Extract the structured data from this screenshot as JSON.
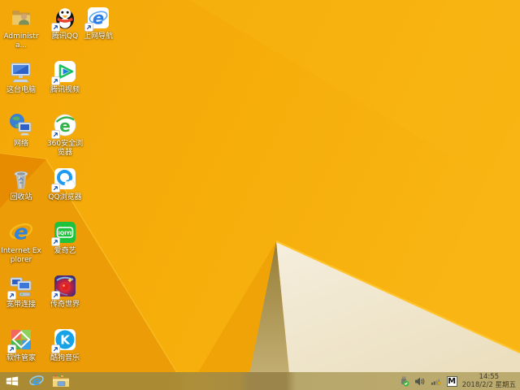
{
  "desktop": {
    "icons": {
      "admin": {
        "label": "Administra..."
      },
      "qq": {
        "label": "腾讯QQ"
      },
      "webnav": {
        "label": "上网导航"
      },
      "thispc": {
        "label": "这台电脑"
      },
      "tvideo": {
        "label": "腾讯视频"
      },
      "network": {
        "label": "网络"
      },
      "browser360": {
        "label": "360安全浏览器"
      },
      "recycle": {
        "label": "回收站"
      },
      "qqbrowser": {
        "label": "QQ浏览器"
      },
      "ie": {
        "label": "Internet Explorer"
      },
      "iqiyi": {
        "label": "爱奇艺"
      },
      "broadband": {
        "label": "宽带连接"
      },
      "chuanqi": {
        "label": "传奇世界"
      },
      "softmgr": {
        "label": "软件管家"
      },
      "kugou": {
        "label": "酷狗音乐"
      }
    },
    "colors": {
      "wallpaper_gold": "#f6ae0b",
      "wallpaper_dark_orange": "#ec9c06",
      "wallpaper_deep_orange": "#e78c01",
      "wallpaper_cream": "#f3ead6",
      "wallpaper_olive_shadow": "#a98e4e",
      "taskbar_left": "#aa8a33",
      "taskbar_right": "#bcab6e"
    }
  },
  "taskbar": {
    "tray": {
      "input_indicator": "M",
      "time": "14:55",
      "date": "2018/2/2 星期五"
    }
  }
}
